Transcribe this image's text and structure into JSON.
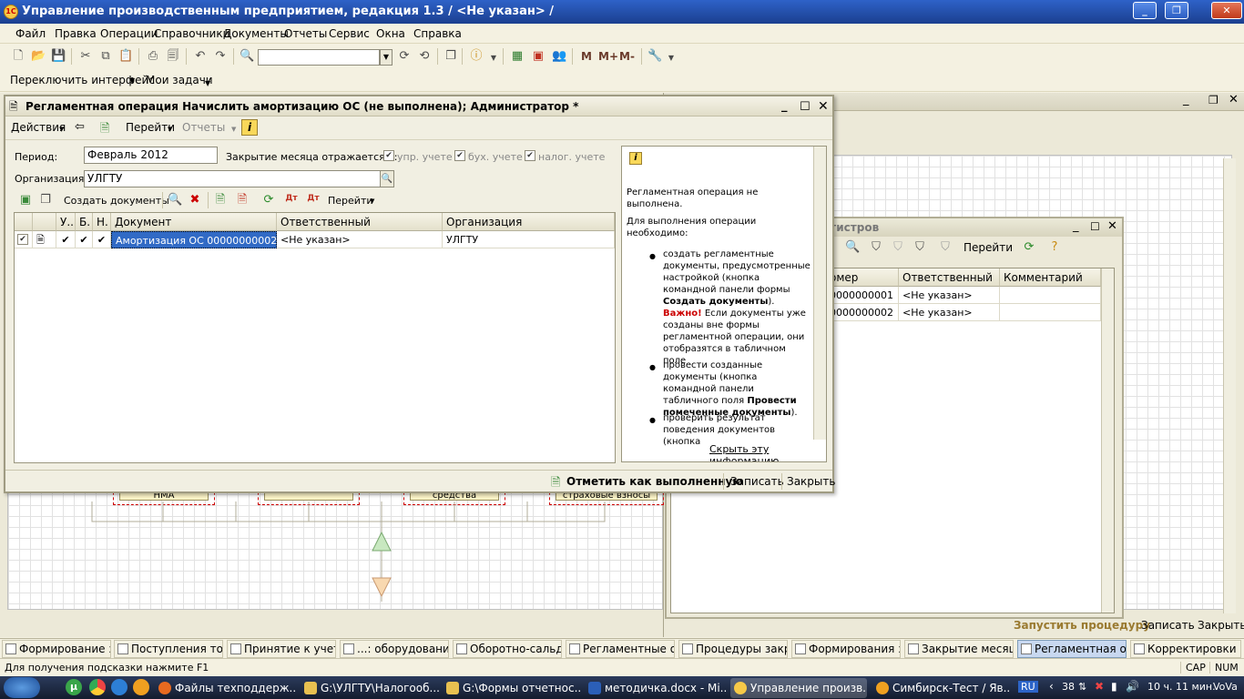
{
  "app": {
    "title": "Управление производственным предприятием, редакция 1.3 / <Не указан> /",
    "logo": "1С"
  },
  "menu": [
    "Файл",
    "Правка",
    "Операции",
    "Справочники",
    "Документы",
    "Отчеты",
    "Сервис",
    "Окна",
    "Справка"
  ],
  "toolbar": {
    "m": "M",
    "mplus": "M+",
    "mminus": "M-"
  },
  "iface": {
    "switch": "Переключить интерфейс",
    "tasks": "Мои задачи"
  },
  "dialog": {
    "title": "Регламентная операция Начислить амортизацию ОС (не выполнена); Администратор *",
    "cmd": {
      "actions": "Действия",
      "goto": "Перейти",
      "reports": "Отчеты"
    },
    "period_label": "Период:",
    "period_value": "Февраль 2012",
    "closing_label": "Закрытие месяца отражается в:",
    "checks": [
      "упр. учете",
      "бух. учете",
      "налог. учете"
    ],
    "org_label": "Организация:",
    "org_value": "УЛГТУ",
    "grid_toolbar": {
      "create": "Создать документы",
      "goto": "Перейти"
    },
    "columns": [
      "У..",
      "Б.",
      "Н.",
      "Документ",
      "Ответственный",
      "Организация"
    ],
    "rows": [
      {
        "doc": "Амортизация ОС 00000000002 о...",
        "resp": "<Не указан>",
        "org": "УЛГТУ"
      }
    ],
    "info": {
      "p1": "Регламентная операция не выполнена.",
      "p2": "Для выполнения операции необходимо:",
      "b1a": "создать регламентные документы, предусмотренные настройкой (кнопка командной панели формы ",
      "b1b": "Создать документы",
      "b1c": "). ",
      "b1d": "Важно!",
      "b1e": " Если документы уже созданы вне формы регламентной операции, они отобразятся в табличном поле",
      "b2a": "провести созданные документы (кнопка командной панели табличного поля ",
      "b2b": "Провести помеченные документы",
      "b2c": ").",
      "b3": "проверить результат поведения документов (кнопка",
      "hide": "Скрыть эту информацию"
    },
    "footer": {
      "mark": "Отметить как выполненную",
      "save": "Записать",
      "close": "Закрыть"
    }
  },
  "regwin": {
    "title": "гистров",
    "goto": "Перейти",
    "columns": [
      "омер",
      "Ответственный",
      "Комментарий"
    ],
    "rows": [
      {
        "num": "0000000001",
        "resp": "<Не указан>",
        "comment": ""
      },
      {
        "num": "0000000002",
        "resp": "<Не указан>",
        "comment": ""
      }
    ]
  },
  "procwin": {
    "run": "Запустить процедуру",
    "save": "Записать",
    "close": "Закрыть"
  },
  "diagram": {
    "boxes": [
      "НМА",
      "",
      "средства",
      "страховые взносы"
    ]
  },
  "wintabs": [
    "Формирование з...",
    "Поступления това...",
    "Принятие к учету ...",
    "...: оборудование....",
    "Оборотно-сальдо...",
    "Регламентные оп...",
    "Процедуры закры...",
    "Формирования з...",
    "Закрытие месяца...",
    "Регламентная оп...",
    "Корректировки з..."
  ],
  "status": {
    "hint": "Для получения подсказки нажмите F1",
    "cap": "CAP",
    "num": "NUM"
  },
  "taskbar": {
    "items": [
      "Файлы техподдерж...",
      "G:\\УЛГТУ\\Налогооб...",
      "G:\\Формы отчетнос...",
      "методичка.docx - Mi...",
      "Управление произв...",
      "Симбирск-Тест / Яв..."
    ],
    "lang": "RU",
    "tray_num": "38",
    "clock": "10 ч. 11 мин.",
    "user": "VoVa"
  }
}
